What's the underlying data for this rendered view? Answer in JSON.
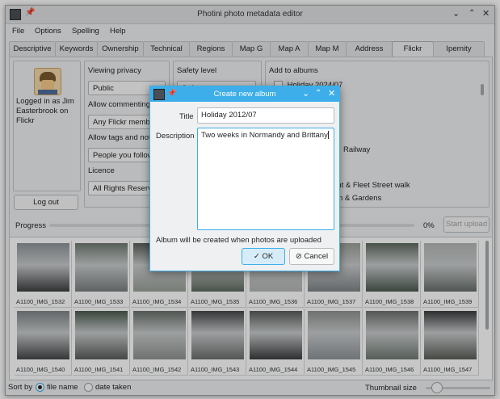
{
  "window": {
    "title": "Photini photo metadata editor"
  },
  "menu": [
    "File",
    "Options",
    "Spelling",
    "Help"
  ],
  "tabs": [
    "Descriptive",
    "Keywords",
    "Ownership",
    "Technical",
    "Regions",
    "Map G",
    "Map A",
    "Map M",
    "Address",
    "Flickr",
    "Ipernity"
  ],
  "active_tab": "Flickr",
  "user": {
    "status": "Logged in as Jim Easterbrook on Flickr",
    "logout_label": "Log out"
  },
  "settings": {
    "viewing_privacy_label": "Viewing privacy",
    "viewing_privacy_value": "Public",
    "allow_commenting_label": "Allow commenting",
    "allow_commenting_value": "Any Flickr member",
    "allow_tags_label": "Allow tags and notes",
    "allow_tags_value": "People you follow",
    "licence_label": "Licence",
    "licence_value": "All Rights Reserved",
    "safety_label": "Safety level",
    "safety_value": "Safe"
  },
  "albums": {
    "label": "Add to albums",
    "visible_items": [
      "Holiday 2024/07",
      "Railway",
      "ent & Fleet Street walk",
      "n & Gardens"
    ]
  },
  "progress": {
    "label": "Progress",
    "value_text": "0%",
    "fraction": 0,
    "start_label": "Start upload"
  },
  "thumbnails": [
    "A1100_IMG_1532",
    "A1100_IMG_1533",
    "A1100_IMG_1534",
    "A1100_IMG_1535",
    "A1100_IMG_1536",
    "A1100_IMG_1537",
    "A1100_IMG_1538",
    "A1100_IMG_1539",
    "A1100_IMG_1540",
    "A1100_IMG_1541",
    "A1100_IMG_1542",
    "A1100_IMG_1543",
    "A1100_IMG_1544",
    "A1100_IMG_1545",
    "A1100_IMG_1546",
    "A1100_IMG_1547"
  ],
  "status": {
    "sort_label": "Sort by",
    "sort_file": "file name",
    "sort_date": "date taken",
    "thumb_size_label": "Thumbnail size"
  },
  "dialog": {
    "title": "Create new album",
    "title_label": "Title",
    "title_value": "Holiday 2012/07",
    "description_label": "Description",
    "description_value": "Two weeks in Normandy and Brittany",
    "note": "Album will be created when photos are uploaded",
    "ok_label": "OK",
    "cancel_label": "Cancel"
  },
  "colors": {
    "accent": "#3daee9",
    "window_bg": "#eff0f1"
  }
}
